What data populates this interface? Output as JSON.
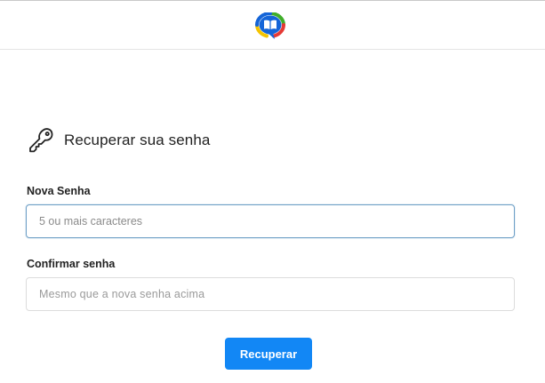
{
  "header": {
    "logo_icon": "book-speech-bubble-logo",
    "colors": {
      "blue": "#1565d8",
      "green": "#3fae2a",
      "yellow": "#f5c400",
      "red": "#e53935"
    }
  },
  "main": {
    "title_icon": "key-icon",
    "title": "Recuperar sua senha",
    "new_password": {
      "label": "Nova Senha",
      "value": "",
      "placeholder": "5 ou mais caracteres"
    },
    "confirm_password": {
      "label": "Confirmar senha",
      "value": "",
      "placeholder": "Mesmo que a nova senha acima"
    },
    "submit_label": "Recuperar",
    "accent_color": "#1287f5"
  }
}
